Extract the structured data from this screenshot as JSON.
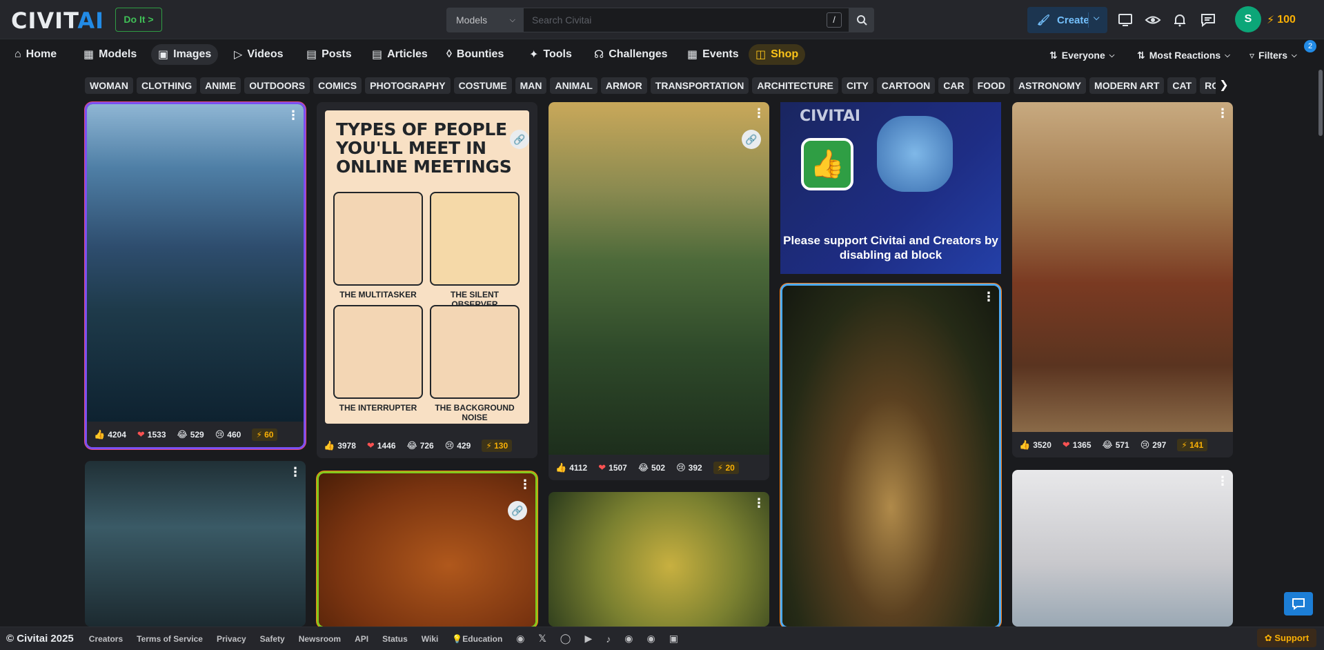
{
  "header": {
    "logo_text": "CIVITAI",
    "do_it_label": "Do It >",
    "search_scope": "Models",
    "search_placeholder": "Search Civitai",
    "search_shortcut": "/",
    "create_label": "Create",
    "avatar_initial": "S",
    "buzz_count": "100"
  },
  "nav": {
    "items": [
      {
        "label": "Home",
        "icon": "home-icon"
      },
      {
        "label": "Models",
        "icon": "models-icon"
      },
      {
        "label": "Images",
        "icon": "image-icon",
        "active": true
      },
      {
        "label": "Videos",
        "icon": "video-icon"
      },
      {
        "label": "Posts",
        "icon": "posts-icon"
      },
      {
        "label": "Articles",
        "icon": "article-icon"
      },
      {
        "label": "Bounties",
        "icon": "bounty-icon"
      },
      {
        "label": "Tools",
        "icon": "tools-icon"
      },
      {
        "label": "Challenges",
        "icon": "trophy-icon"
      },
      {
        "label": "Events",
        "icon": "calendar-icon"
      },
      {
        "label": "Shop",
        "icon": "shop-icon"
      }
    ],
    "audience": "Everyone",
    "sort": "Most Reactions",
    "filters": "Filters",
    "filters_badge": "2"
  },
  "tags": [
    "WOMAN",
    "CLOTHING",
    "ANIME",
    "OUTDOORS",
    "COMICS",
    "PHOTOGRAPHY",
    "COSTUME",
    "MAN",
    "ANIMAL",
    "ARMOR",
    "TRANSPORTATION",
    "ARCHITECTURE",
    "CITY",
    "CARTOON",
    "CAR",
    "FOOD",
    "ASTRONOMY",
    "MODERN ART",
    "CAT",
    "ROBOT"
  ],
  "cards": [
    {
      "like": "4204",
      "heart": "1533",
      "laugh": "529",
      "cry": "460",
      "buzz": "60"
    },
    {
      "like": "3978",
      "heart": "1446",
      "laugh": "726",
      "cry": "429",
      "buzz": "130"
    },
    {
      "like": "4112",
      "heart": "1507",
      "laugh": "502",
      "cry": "392",
      "buzz": "20"
    },
    {
      "like": "3520",
      "heart": "1365",
      "laugh": "571",
      "cry": "297",
      "buzz": "141"
    }
  ],
  "poster": {
    "title": "TYPES OF PEOPLE YOU'LL MEET IN ONLINE MEETINGS",
    "labels": [
      "THE MULTITASKER",
      "THE SILENT OBSERVER",
      "THE INTERRUPTER",
      "THE BACKGROUND NOISE"
    ]
  },
  "ad": {
    "brand": "CIVITAI",
    "text": "Please support Civitai and Creators by disabling ad block"
  },
  "footer": {
    "copyright": "© Civitai 2025",
    "links": [
      "Creators",
      "Terms of Service",
      "Privacy",
      "Safety",
      "Newsroom",
      "API",
      "Status",
      "Wiki",
      "Education"
    ],
    "support": "Support"
  }
}
